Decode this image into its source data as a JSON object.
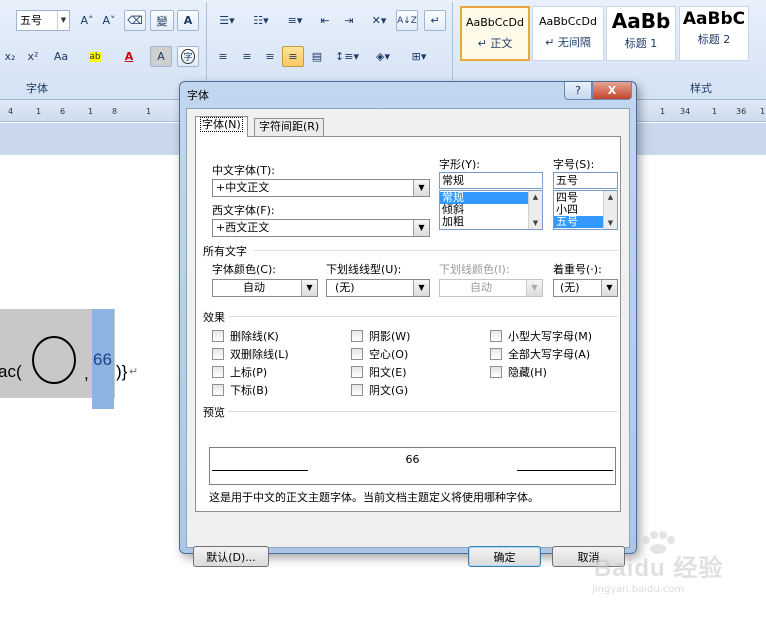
{
  "ribbon": {
    "font_size_value": "五号",
    "group_font_label": "字体",
    "group_style_label": "样式",
    "styles": [
      {
        "sample": "AaBbCcDd",
        "name": "↵ 正文",
        "selected": true
      },
      {
        "sample": "AaBbCcDd",
        "name": "↵ 无间隔",
        "selected": false
      },
      {
        "sample": "AaBb",
        "name": "标题 1",
        "selected": false
      },
      {
        "sample": "AaBbC",
        "name": "标题 2",
        "selected": false
      }
    ],
    "buttons": {
      "grow": "A˄",
      "shrink": "A˅",
      "subscript": "x₂",
      "superscript": "x²",
      "change_case": "Aa",
      "highlight": "ab",
      "font_color": "A",
      "char_shading": "A",
      "enclose": "字",
      "phonetic": "變",
      "sort": "A↓Z"
    },
    "ruler_ticks": [
      "4",
      "1",
      "6",
      "1",
      "8",
      "1",
      "10",
      "1",
      "34",
      "1",
      "36",
      "1"
    ]
  },
  "document": {
    "text_left": "ac(",
    "text_comma": ",",
    "text_sel": "66",
    "text_close": ")}",
    "para_mark": "↵"
  },
  "dialog": {
    "title": "字体",
    "help": "?",
    "close": "X",
    "tabs": [
      "字体(N)",
      "字符间距(R)"
    ],
    "chinese_font": {
      "label": "中文字体(T):",
      "value": "+中文正文"
    },
    "western_font": {
      "label": "西文字体(F):",
      "value": "+西文正文"
    },
    "style": {
      "label": "字形(Y):",
      "value": "常规",
      "options": [
        "常规",
        "倾斜",
        "加粗"
      ],
      "selected": "常规"
    },
    "size": {
      "label": "字号(S):",
      "value": "五号",
      "options": [
        "四号",
        "小四",
        "五号"
      ],
      "selected": "五号"
    },
    "all_text_section": "所有文字",
    "font_color": {
      "label": "字体颜色(C):",
      "value": "自动"
    },
    "underline_style": {
      "label": "下划线线型(U):",
      "value": "(无)"
    },
    "underline_color": {
      "label": "下划线颜色(I):",
      "value": "自动"
    },
    "emphasis": {
      "label": "着重号(·):",
      "value": "(无)"
    },
    "effects_section": "效果",
    "effects": [
      "删除线(K)",
      "阴影(W)",
      "小型大写字母(M)",
      "双删除线(L)",
      "空心(O)",
      "全部大写字母(A)",
      "上标(P)",
      "阳文(E)",
      "隐藏(H)",
      "下标(B)",
      "阴文(G)"
    ],
    "preview_section": "预览",
    "preview_text": "66",
    "preview_note": "这是用于中文的正文主题字体。当前文档主题定义将使用哪种字体。",
    "default_button": "默认(D)...",
    "ok_button": "确定",
    "cancel_button": "取消"
  },
  "watermark": {
    "logo": "Baidu 经验",
    "url": "jingyan.baidu.com"
  },
  "colors": {
    "accent": "#3399ff",
    "ribbon_bg": "#d4e2f4",
    "dialog_frame": "#adc6e6",
    "selection": "#8db3e0"
  }
}
